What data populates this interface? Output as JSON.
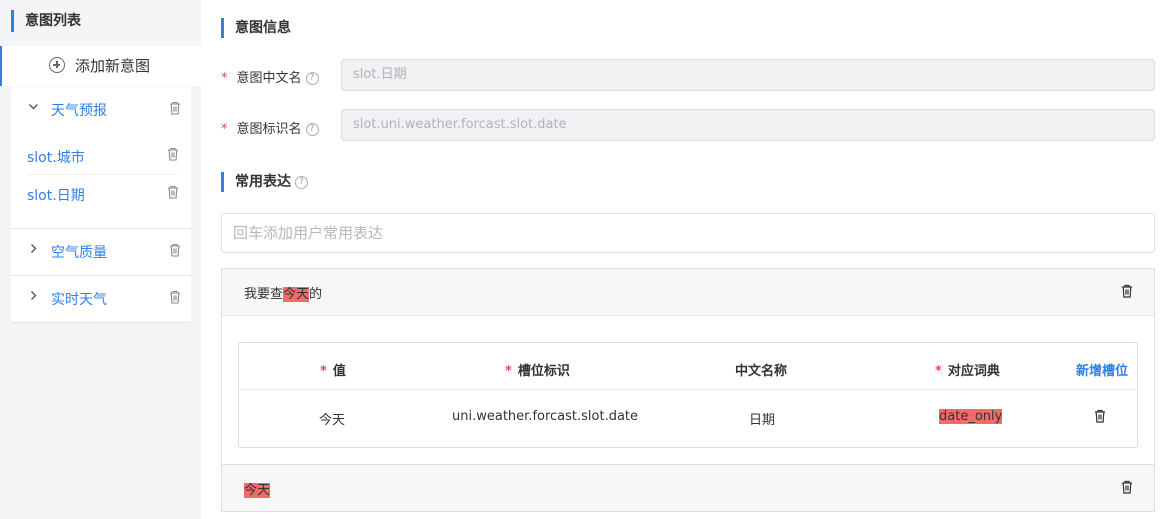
{
  "sidebar": {
    "title": "意图列表",
    "add_label": "添加新意图",
    "groups": [
      {
        "label": "天气预报",
        "expanded": true,
        "arrow": "⌄",
        "slots": [
          {
            "label": "slot.城市"
          },
          {
            "label": "slot.日期"
          }
        ]
      },
      {
        "label": "空气质量",
        "expanded": false,
        "arrow": "›"
      },
      {
        "label": "实时天气",
        "expanded": false,
        "arrow": "›"
      }
    ]
  },
  "intent_info": {
    "title": "意图信息",
    "cn_name_label": "意图中文名",
    "cn_name_value": "slot.日期",
    "id_label": "意图标识名",
    "id_value": "slot.uni.weather.forcast.slot.date"
  },
  "expressions": {
    "title": "常用表达",
    "input_placeholder": "回车添加用户常用表达",
    "items": [
      {
        "prefix": "我要查",
        "highlight": "今天",
        "suffix": "的",
        "table": {
          "headers": {
            "value": "值",
            "slot_id": "槽位标识",
            "cn_name": "中文名称",
            "dict": "对应词典",
            "add": "新增槽位"
          },
          "rows": [
            {
              "value": "今天",
              "slot_id": "uni.weather.forcast.slot.date",
              "cn_name": "日期",
              "dict": "date_only"
            }
          ]
        }
      },
      {
        "prefix": "",
        "highlight": "今天",
        "suffix": ""
      }
    ]
  },
  "colors": {
    "accent": "#2f80ed",
    "highlight": "#f26b6b",
    "required": "#e84a4a"
  },
  "icons": {
    "delete": "trash-icon",
    "add": "plus-circle-icon",
    "help": "help-icon",
    "expand": "chevron-down-icon",
    "collapse": "chevron-right-icon"
  }
}
